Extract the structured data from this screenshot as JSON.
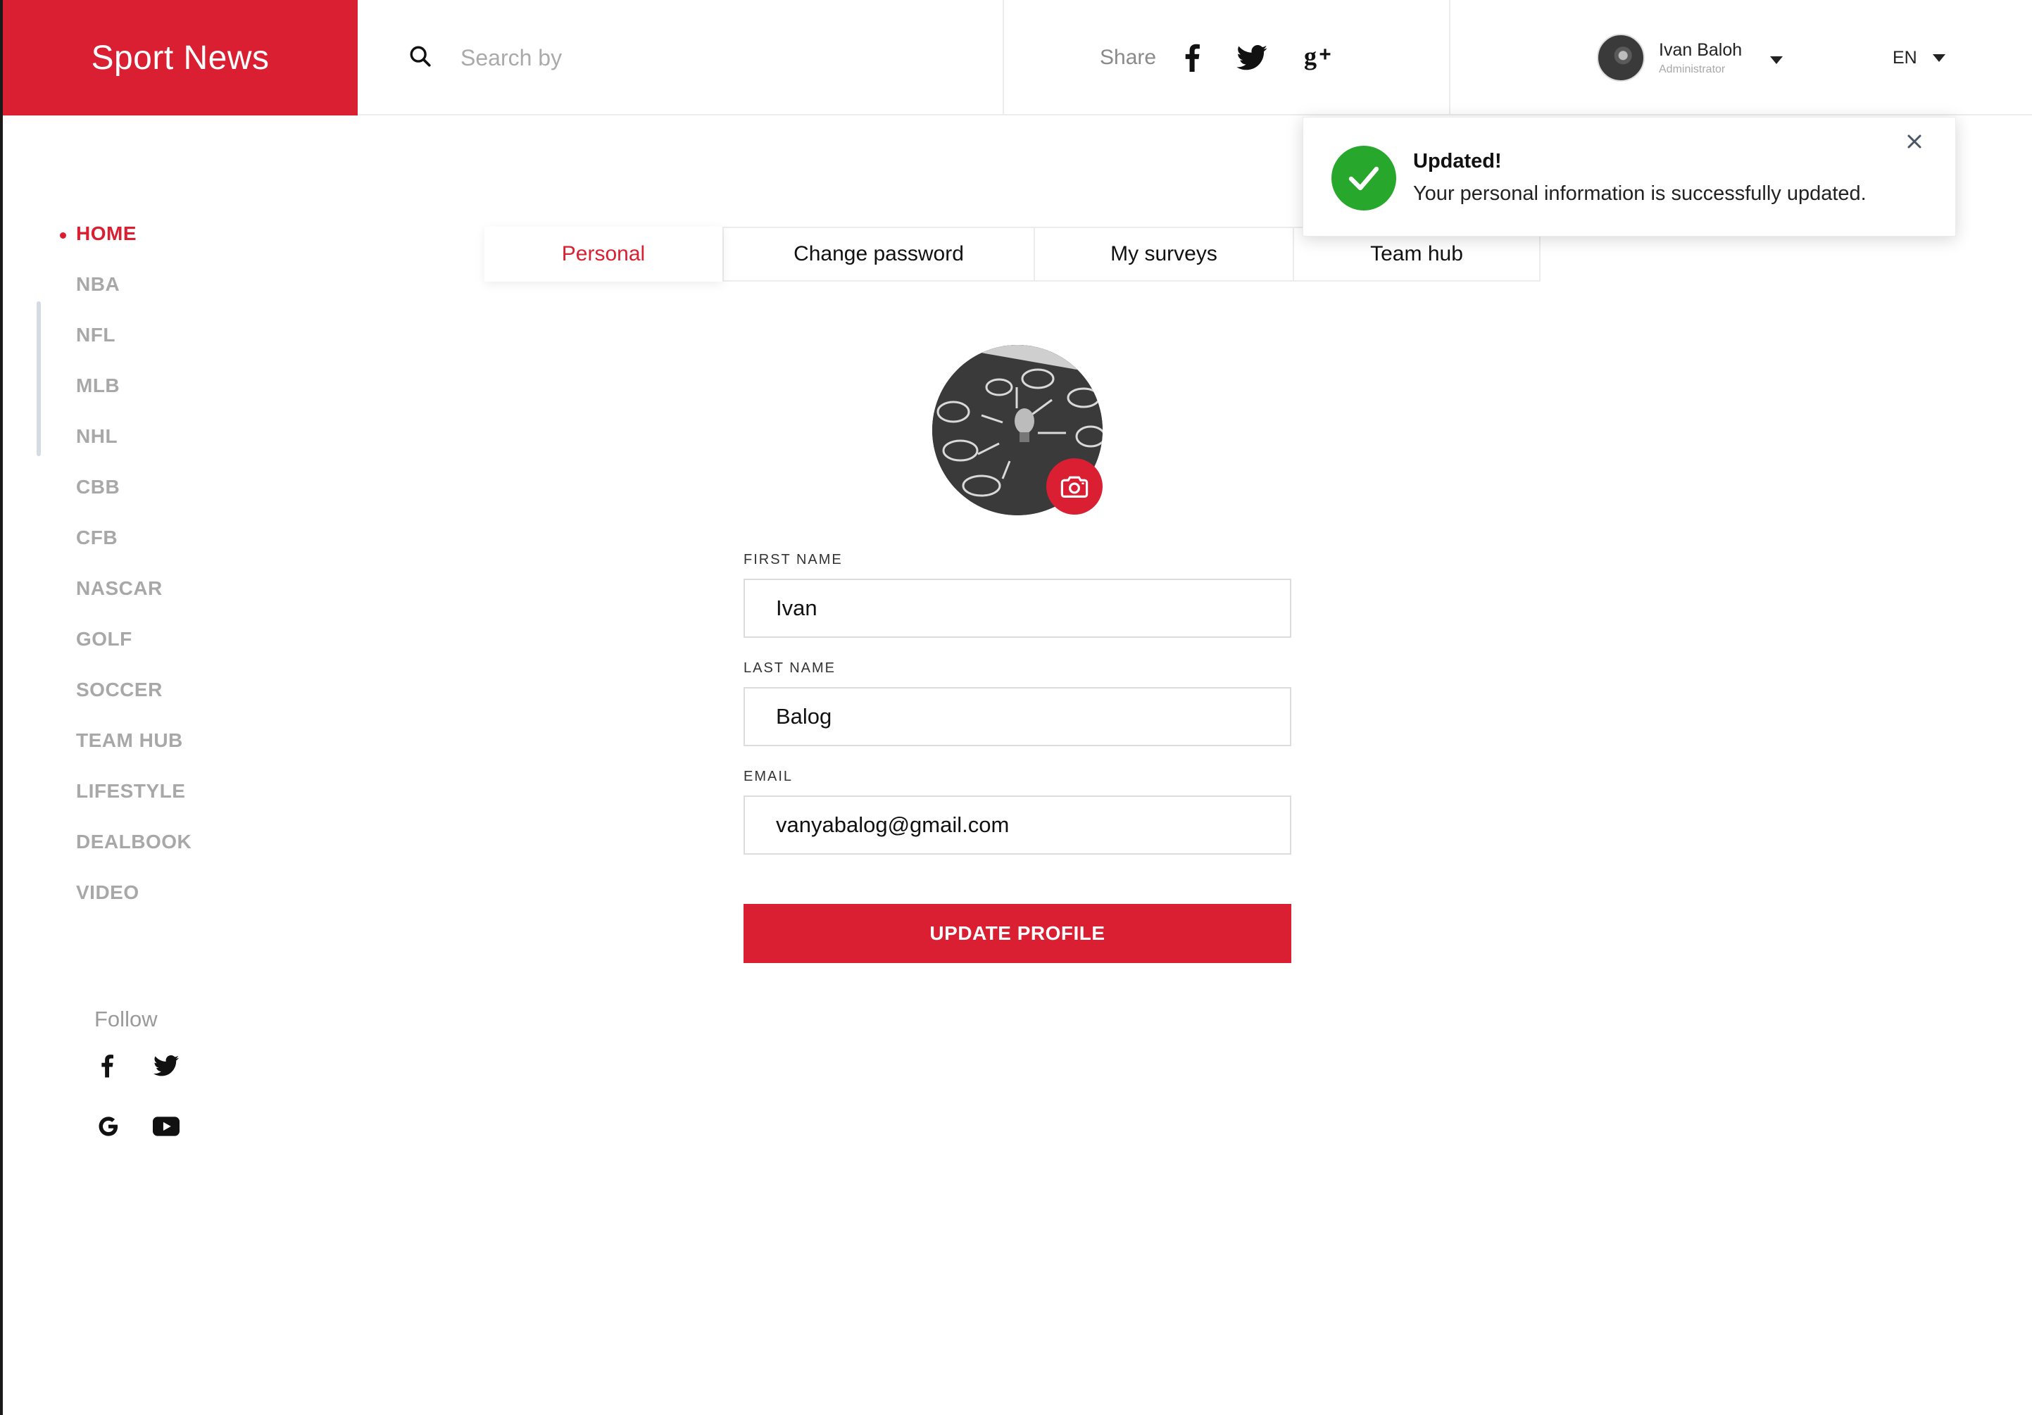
{
  "header": {
    "brand": "Sport News",
    "search": {
      "placeholder": "Search by",
      "icon": "search-icon"
    },
    "share": {
      "label": "Share",
      "icons": [
        "facebook-icon",
        "twitter-icon",
        "google-plus-icon"
      ]
    },
    "user": {
      "name": "Ivan Baloh",
      "role": "Administrator"
    },
    "language": "EN"
  },
  "sidebar": {
    "items": [
      {
        "label": "HOME",
        "active": true
      },
      {
        "label": "NBA"
      },
      {
        "label": "NFL"
      },
      {
        "label": "MLB"
      },
      {
        "label": "NHL"
      },
      {
        "label": "CBB"
      },
      {
        "label": "CFB"
      },
      {
        "label": "NASCAR"
      },
      {
        "label": "GOLF"
      },
      {
        "label": "SOCCER"
      },
      {
        "label": "TEAM HUB"
      },
      {
        "label": "LIFESTYLE"
      },
      {
        "label": "DEALBOOK"
      },
      {
        "label": "VIDEO"
      }
    ],
    "follow": {
      "label": "Follow",
      "icons": [
        "facebook-icon",
        "twitter-icon",
        "google-icon",
        "youtube-icon"
      ]
    }
  },
  "tabs": [
    {
      "label": "Personal",
      "active": true
    },
    {
      "label": "Change password"
    },
    {
      "label": "My surveys"
    },
    {
      "label": "Team hub"
    }
  ],
  "profile": {
    "first_name": {
      "label": "FIRST NAME",
      "value": "Ivan"
    },
    "last_name": {
      "label": "LAST NAME",
      "value": "Balog"
    },
    "email": {
      "label": "EMAIL",
      "value": "vanyabalog@gmail.com"
    },
    "update_button": "UPDATE PROFILE"
  },
  "toast": {
    "title": "Updated!",
    "message": "Your personal information is successfully updated."
  },
  "colors": {
    "accent": "#d91f31",
    "success": "#27a82c",
    "muted": "#a8a8a8"
  }
}
